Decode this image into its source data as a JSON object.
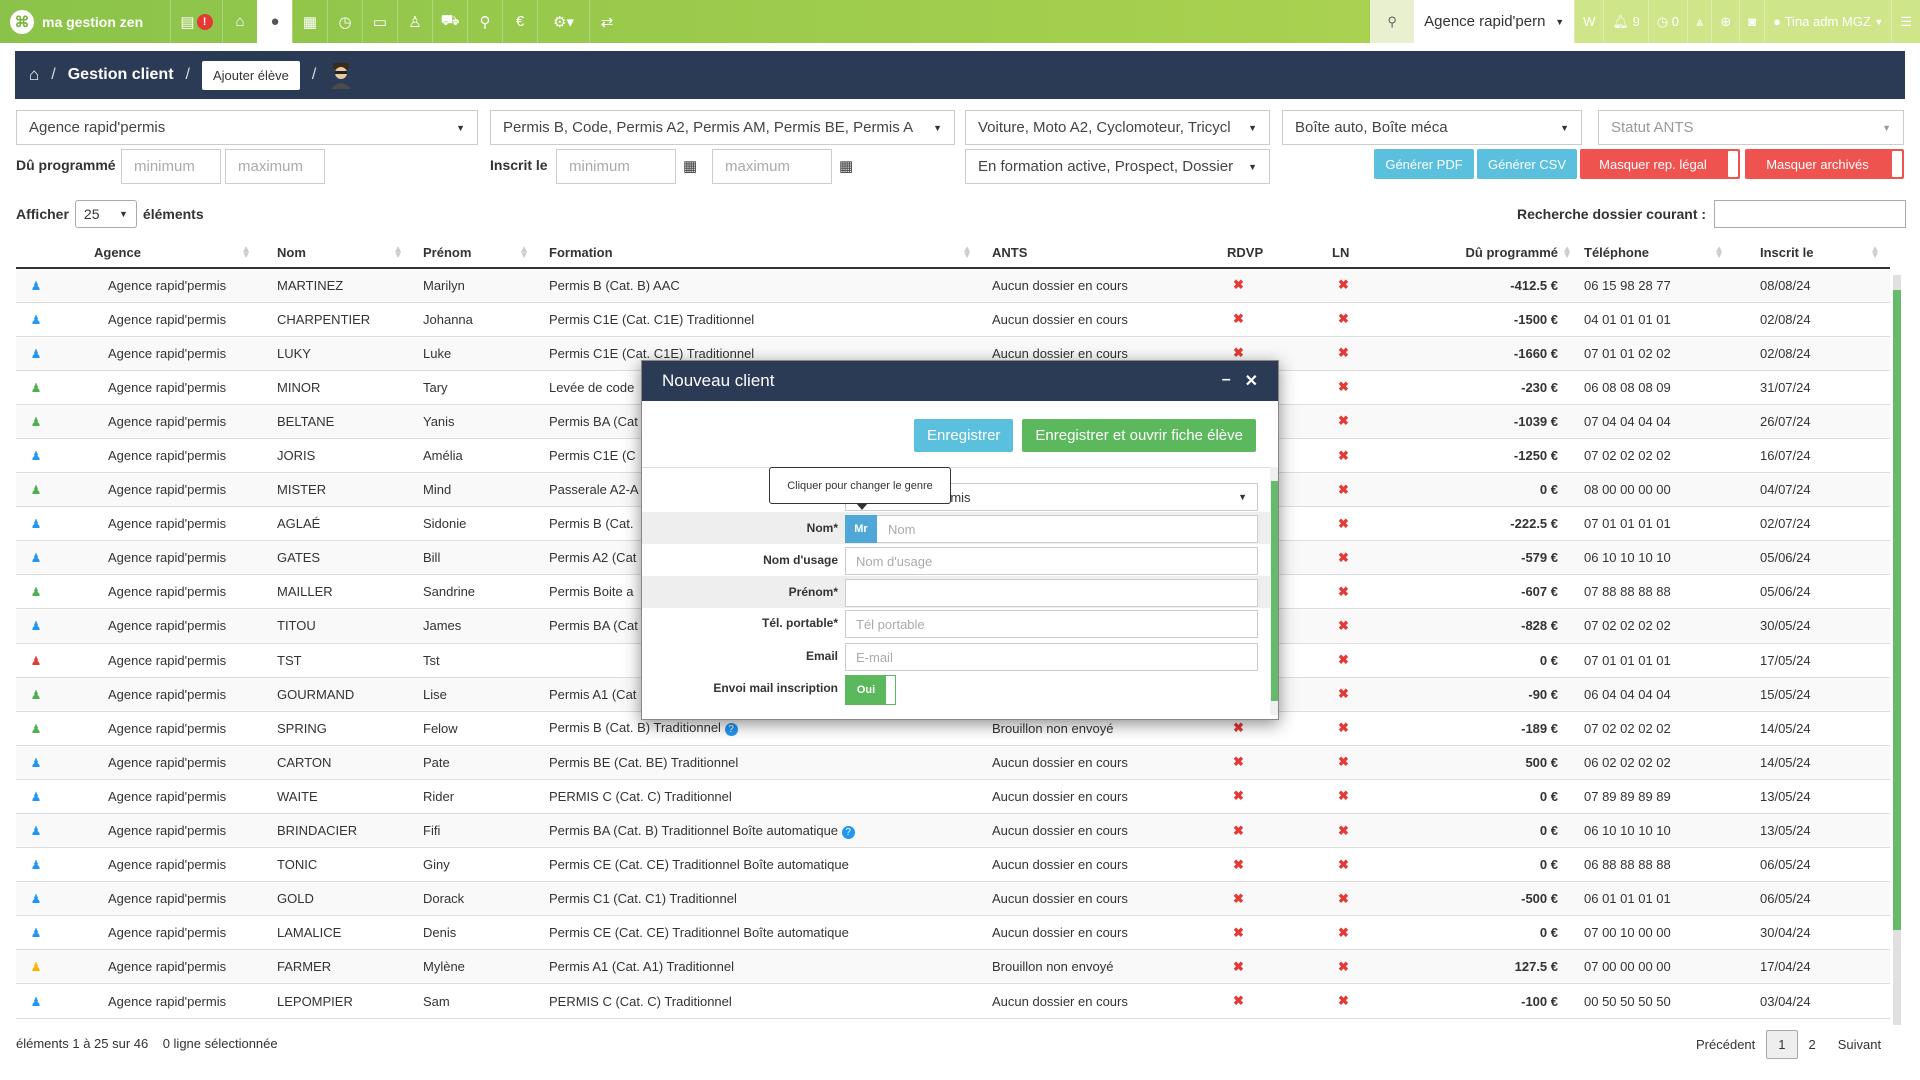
{
  "app": {
    "brand": "ma gestion zen"
  },
  "nav": {
    "agency": "Agence rapid'pern",
    "w_label": "W",
    "notif_count": "9",
    "alarm_count": "0",
    "user": "Tina adm MGZ"
  },
  "breadcrumb": {
    "title": "Gestion client",
    "add_button": "Ajouter élève"
  },
  "filters": {
    "agency": "Agence rapid'permis",
    "permis": "Permis B, Code, Permis A2, Permis AM, Permis BE, Permis A",
    "vehicles": "Voiture, Moto A2, Cyclomoteur, Tricycl",
    "boite": "Boîte auto, Boîte méca",
    "ants_placeholder": "Statut ANTS",
    "du_label": "Dû programmé",
    "min_placeholder": "minimum",
    "max_placeholder": "maximum",
    "inscrit_label": "Inscrit le",
    "status": "En formation active, Prospect, Dossier",
    "pdf_button": "Générer PDF",
    "csv_button": "Générer CSV",
    "mask_rep_button": "Masquer rep. légal",
    "mask_arch_button": "Masquer archivés"
  },
  "list": {
    "show_label": "Afficher",
    "page_size": "25",
    "elements_label": "éléments",
    "search_label": "Recherche dossier courant :"
  },
  "table": {
    "headers": {
      "agence": "Agence",
      "nom": "Nom",
      "prenom": "Prénom",
      "formation": "Formation",
      "ants": "ANTS",
      "rdvp": "RDVP",
      "ln": "LN",
      "du": "Dû programmé",
      "telephone": "Téléphone",
      "inscrit": "Inscrit le"
    },
    "rows": [
      {
        "color": "#2196f3",
        "agence": "Agence rapid'permis",
        "nom": "MARTINEZ",
        "prenom": "Marilyn",
        "formation": "Permis B (Cat. B) AAC",
        "ants": "Aucun dossier en cours",
        "du": "-412.5 €",
        "pos": false,
        "tel": "06 15 98 28 77",
        "date": "08/08/24"
      },
      {
        "color": "#2196f3",
        "agence": "Agence rapid'permis",
        "nom": "CHARPENTIER",
        "prenom": "Johanna",
        "formation": "Permis C1E (Cat. C1E) Traditionnel",
        "ants": "Aucun dossier en cours",
        "du": "-1500 €",
        "pos": false,
        "tel": "04 01 01 01 01",
        "date": "02/08/24"
      },
      {
        "color": "#2196f3",
        "agence": "Agence rapid'permis",
        "nom": "LUKY",
        "prenom": "Luke",
        "formation": "Permis C1E (Cat. C1E) Traditionnel",
        "ants": "Aucun dossier en cours",
        "du": "-1660 €",
        "pos": false,
        "tel": "07 01 01 02 02",
        "date": "02/08/24"
      },
      {
        "color": "#4caf50",
        "agence": "Agence rapid'permis",
        "nom": "MINOR",
        "prenom": "Tary",
        "formation": "Levée de code",
        "ants": "",
        "du": "-230 €",
        "pos": false,
        "tel": "06 08 08 08 09",
        "date": "31/07/24"
      },
      {
        "color": "#4caf50",
        "agence": "Agence rapid'permis",
        "nom": "BELTANE",
        "prenom": "Yanis",
        "formation": "Permis BA (Cat",
        "ants": "",
        "du": "-1039 €",
        "pos": false,
        "tel": "07 04 04 04 04",
        "date": "26/07/24"
      },
      {
        "color": "#2196f3",
        "agence": "Agence rapid'permis",
        "nom": "JORIS",
        "prenom": "Amélia",
        "formation": "Permis C1E (C",
        "ants": "",
        "du": "-1250 €",
        "pos": false,
        "tel": "07 02 02 02 02",
        "date": "16/07/24"
      },
      {
        "color": "#4caf50",
        "agence": "Agence rapid'permis",
        "nom": "MISTER",
        "prenom": "Mind",
        "formation": "Passerale A2-A",
        "ants": "",
        "du": "0 €",
        "pos": true,
        "tel": "08 00 00 00 00",
        "date": "04/07/24"
      },
      {
        "color": "#2196f3",
        "agence": "Agence rapid'permis",
        "nom": "AGLAÉ",
        "prenom": "Sidonie",
        "formation": "Permis B (Cat.",
        "ants": "",
        "du": "-222.5 €",
        "pos": false,
        "tel": "07 01 01 01 01",
        "date": "02/07/24"
      },
      {
        "color": "#2196f3",
        "agence": "Agence rapid'permis",
        "nom": "GATES",
        "prenom": "Bill",
        "formation": "Permis A2 (Cat",
        "ants": "",
        "du": "-579 €",
        "pos": false,
        "tel": "06 10 10 10 10",
        "date": "05/06/24"
      },
      {
        "color": "#4caf50",
        "agence": "Agence rapid'permis",
        "nom": "MAILLER",
        "prenom": "Sandrine",
        "formation": "Permis Boite a",
        "ants": "",
        "du": "-607 €",
        "pos": false,
        "tel": "07 88 88 88 88",
        "date": "05/06/24"
      },
      {
        "color": "#2196f3",
        "agence": "Agence rapid'permis",
        "nom": "TITOU",
        "prenom": "James",
        "formation": "Permis BA (Cat",
        "ants": "",
        "du": "-828 €",
        "pos": false,
        "tel": "07 02 02 02 02",
        "date": "30/05/24"
      },
      {
        "color": "#e53935",
        "agence": "Agence rapid'permis",
        "nom": "TST",
        "prenom": "Tst",
        "formation": "",
        "ants": "",
        "du": "0 €",
        "pos": true,
        "tel": "07 01 01 01 01",
        "date": "17/05/24"
      },
      {
        "color": "#4caf50",
        "agence": "Agence rapid'permis",
        "nom": "GOURMAND",
        "prenom": "Lise",
        "formation": "Permis A1 (Cat",
        "ants": "",
        "du": "-90 €",
        "pos": false,
        "tel": "06 04 04 04 04",
        "date": "15/05/24"
      },
      {
        "color": "#4caf50",
        "agence": "Agence rapid'permis",
        "nom": "SPRING",
        "prenom": "Felow",
        "formation": "Permis B (Cat. B) Traditionnel",
        "help": true,
        "ants": "Brouillon non envoyé",
        "du": "-189 €",
        "pos": false,
        "tel": "07 02 02 02 02",
        "date": "14/05/24"
      },
      {
        "color": "#2196f3",
        "agence": "Agence rapid'permis",
        "nom": "CARTON",
        "prenom": "Pate",
        "formation": "Permis BE (Cat. BE) Traditionnel",
        "ants": "Aucun dossier en cours",
        "du": "500 €",
        "pos": true,
        "tel": "06 02 02 02 02",
        "date": "14/05/24"
      },
      {
        "color": "#2196f3",
        "agence": "Agence rapid'permis",
        "nom": "WAITE",
        "prenom": "Rider",
        "formation": "PERMIS C (Cat. C) Traditionnel",
        "ants": "Aucun dossier en cours",
        "du": "0 €",
        "pos": true,
        "tel": "07 89 89 89 89",
        "date": "13/05/24"
      },
      {
        "color": "#2196f3",
        "agence": "Agence rapid'permis",
        "nom": "BRINDACIER",
        "prenom": "Fifi",
        "formation": "Permis BA (Cat. B) Traditionnel Boîte automatique",
        "help": true,
        "ants": "Aucun dossier en cours",
        "du": "0 €",
        "pos": true,
        "tel": "06 10 10 10 10",
        "date": "13/05/24"
      },
      {
        "color": "#2196f3",
        "agence": "Agence rapid'permis",
        "nom": "TONIC",
        "prenom": "Giny",
        "formation": "Permis CE (Cat. CE) Traditionnel Boîte automatique",
        "ants": "Aucun dossier en cours",
        "du": "0 €",
        "pos": true,
        "tel": "06 88 88 88 88",
        "date": "06/05/24"
      },
      {
        "color": "#2196f3",
        "agence": "Agence rapid'permis",
        "nom": "GOLD",
        "prenom": "Dorack",
        "formation": "Permis C1 (Cat. C1) Traditionnel",
        "ants": "Aucun dossier en cours",
        "du": "-500 €",
        "pos": false,
        "tel": "06 01 01 01 01",
        "date": "06/05/24"
      },
      {
        "color": "#2196f3",
        "agence": "Agence rapid'permis",
        "nom": "LAMALICE",
        "prenom": "Denis",
        "formation": "Permis CE (Cat. CE) Traditionnel Boîte automatique",
        "ants": "Aucun dossier en cours",
        "du": "0 €",
        "pos": true,
        "tel": "07 00 10 00 00",
        "date": "30/04/24"
      },
      {
        "color": "#ffb300",
        "agence": "Agence rapid'permis",
        "nom": "FARMER",
        "prenom": "Mylène",
        "formation": "Permis A1 (Cat. A1) Traditionnel",
        "ants": "Brouillon non envoyé",
        "du": "127.5 €",
        "pos": true,
        "tel": "07 00 00 00 00",
        "date": "17/04/24"
      },
      {
        "color": "#2196f3",
        "agence": "Agence rapid'permis",
        "nom": "LEPOMPIER",
        "prenom": "Sam",
        "formation": "PERMIS C (Cat. C) Traditionnel",
        "ants": "Aucun dossier en cours",
        "du": "-100 €",
        "pos": false,
        "tel": "00 50 50 50 50",
        "date": "03/04/24"
      }
    ]
  },
  "footer": {
    "info": "éléments 1 à 25 sur 46",
    "selected": "0 ligne sélectionnée",
    "prev": "Précédent",
    "page1": "1",
    "page2": "2",
    "next": "Suivant"
  },
  "modal": {
    "title": "Nouveau client",
    "save": "Enregistrer",
    "save_open": "Enregistrer et ouvrir fiche élève",
    "tooltip": "Cliquer pour changer le genre",
    "agency_partial": "rmis",
    "nom_label": "Nom*",
    "gender": "Mr",
    "nom_placeholder": "Nom",
    "usage_label": "Nom d'usage",
    "usage_placeholder": "Nom d'usage",
    "prenom_label": "Prénom*",
    "tel_label": "Tél. portable*",
    "tel_placeholder": "Tél portable",
    "email_label": "Email",
    "email_placeholder": "E-mail",
    "mail_label": "Envoi mail inscription",
    "mail_value": "Oui"
  }
}
